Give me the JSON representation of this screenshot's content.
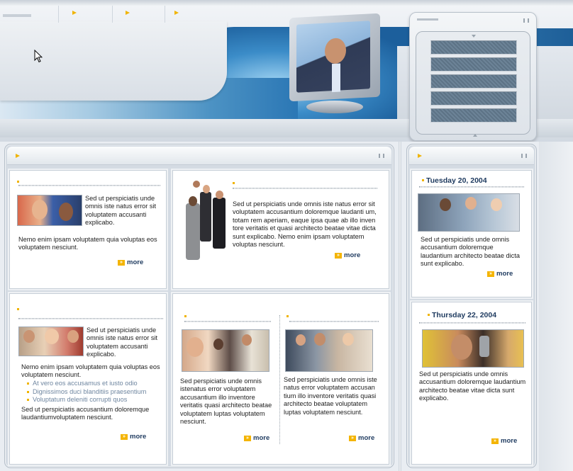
{
  "cards": {
    "c1": {
      "text": "Sed ut perspiciatis unde omnis iste natus error sit voluptatem accusanti explicabo.",
      "text2": "Nemo enim ipsam voluptatem quia voluptas eos voluptatem nesciunt.",
      "more": "more"
    },
    "c2": {
      "text": "Sed ut perspiciatis unde omnis iste natus error sit voluptatem accusantium doloremque laudanti um, totam rem aperiam, eaque ipsa quae ab illo inven tore veritatis et quasi architecto beatae vitae dicta sunt explicabo. Nemo enim ipsam voluptatem voluptas nesciunt.",
      "more": "more"
    },
    "c3": {
      "text": "Sed ut perspiciatis unde omnis iste natus error sit voluptatem accusanti explicabo.",
      "text2": "Nemo enim ipsam voluptatem quia voluptas eos voluptatem nesciunt.",
      "links": [
        "At vero eos accusamus et iusto odio",
        "Dignissimos duci blanditiis praesentium",
        "Voluptatum deleniti corrupti quos"
      ],
      "text3": "Sed ut perspiciatis accusantium doloremque laudantiumvoluptatem nesciunt.",
      "more": "more"
    },
    "c4a": {
      "text": "Sed perspiciatis unde omnis istenatus error voluptatem accusantium illo inventore veritatis quasi architecto beatae voluptatem luptas voluptatem   nesciunt.",
      "more": "more"
    },
    "c4b": {
      "text": "Sed perspiciatis unde omnis iste natus error voluptatem accusan tium illo inventore veritatis quasi architecto beatae voluptatem luptas voluptatem nesciunt.",
      "more": "more"
    }
  },
  "news": [
    {
      "date": "Tuesday 20, 2004",
      "text": "Sed ut perspiciatis unde omnis accusantium doloremque laudantium architecto beatae dicta sunt explicabo.",
      "more": "more"
    },
    {
      "date": "Thursday 22, 2004",
      "text": "Sed ut perspiciatis unde omnis accusantium doloremque laudantium architecto beatae vitae dicta sunt explicabo.",
      "more": "more"
    }
  ],
  "icons": {
    "arrow": "yellow-arrow-icon",
    "more": "double-chevron-icon",
    "grip": "grip-icon",
    "cursor": "mouse-pointer-icon"
  },
  "colors": {
    "accent": "#f0b400",
    "heading": "#1e3a5f",
    "link": "#6f86a0",
    "headerBlue": "#2b77b5"
  }
}
